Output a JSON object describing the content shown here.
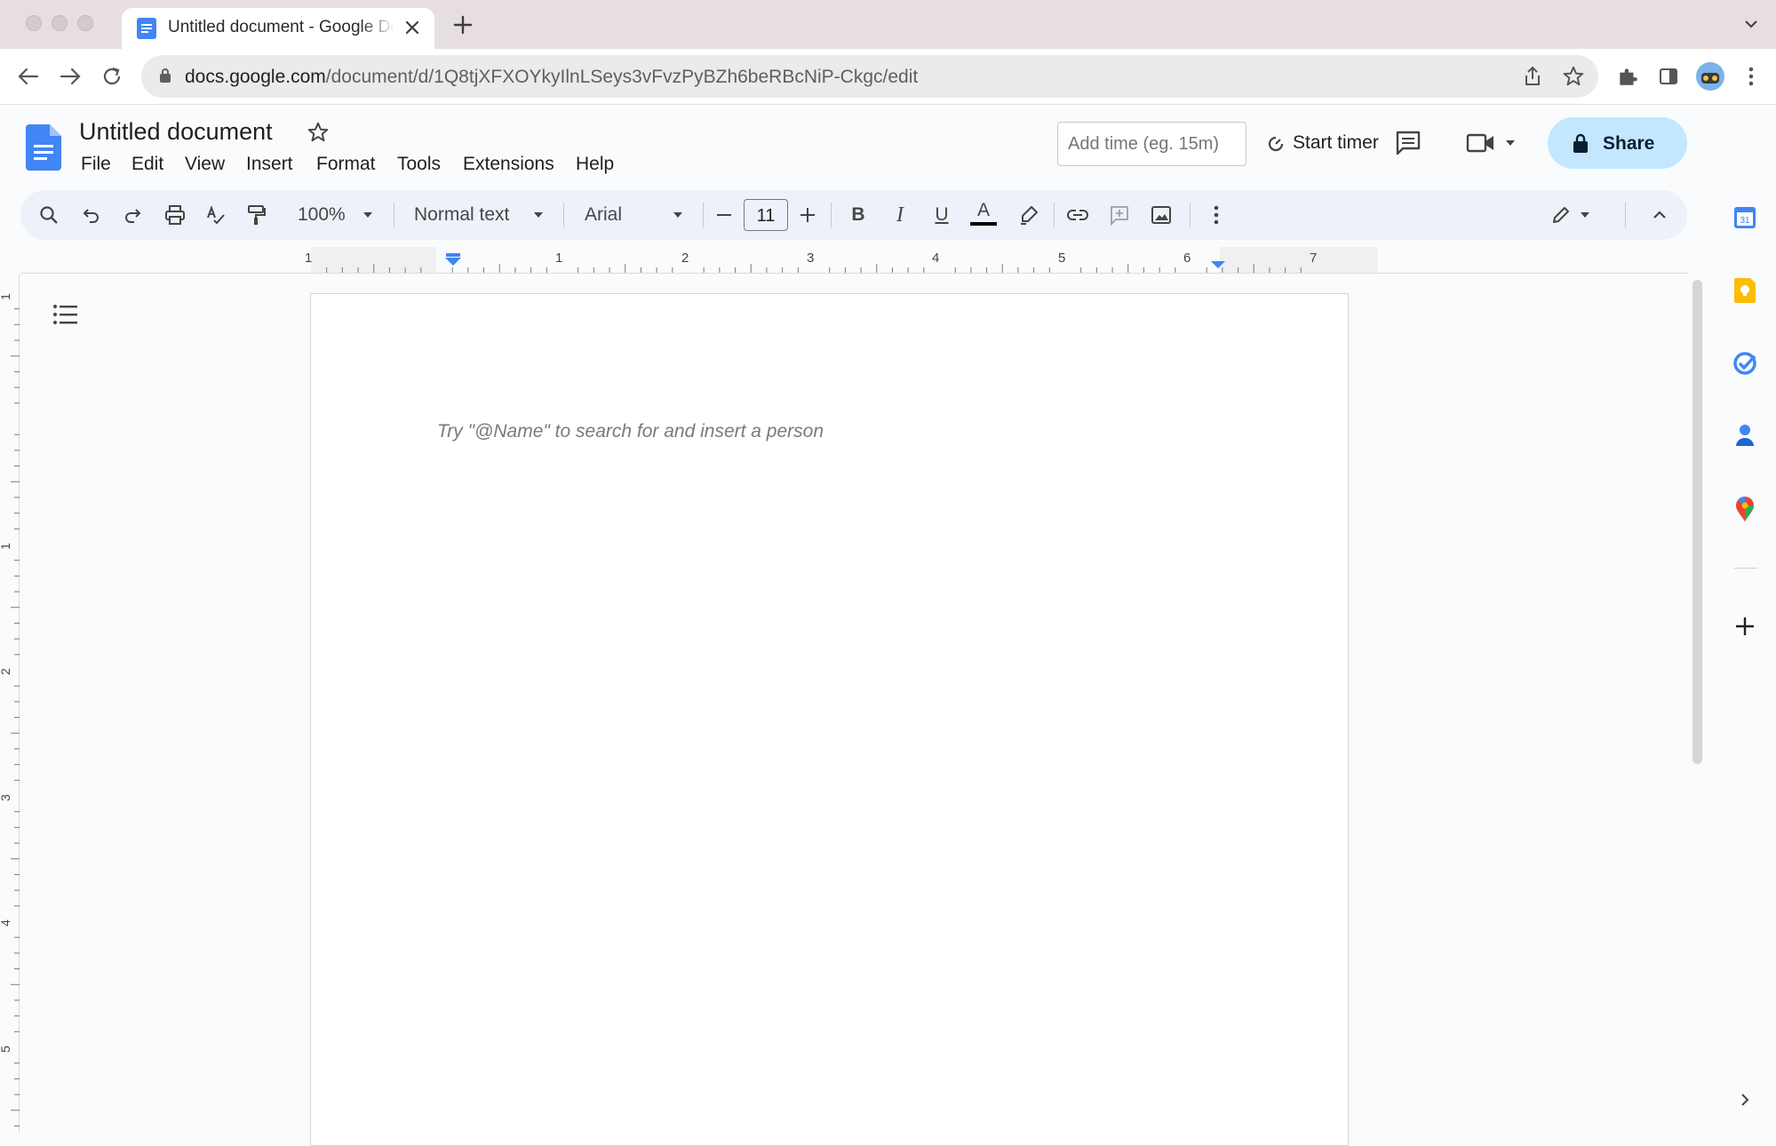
{
  "browser": {
    "tab": {
      "title": "Untitled document - Google Docs",
      "icon": "docs-icon"
    },
    "new_tab_label": "+",
    "url": {
      "host": "docs.google.com",
      "path": "/document/d/1Q8tjXFXOYkyIlnLSeys3vFvzPyBZh6beRBcNiP-Ckgc/edit"
    }
  },
  "doc": {
    "title": "Untitled document",
    "menu": [
      "File",
      "Edit",
      "View",
      "Insert",
      "Format",
      "Tools",
      "Extensions",
      "Help"
    ],
    "add_time_placeholder": "Add time (eg. 15m)",
    "start_timer_label": "Start timer",
    "share_label": "Share"
  },
  "toolbar": {
    "zoom": "100%",
    "style": "Normal text",
    "font": "Arial",
    "font_size": "11",
    "bold_label": "B",
    "italic_label": "I",
    "underline_label": "U",
    "text_color_label": "A",
    "text_color": "#000000"
  },
  "ruler": {
    "horizontal": [
      "1",
      "1",
      "2",
      "3",
      "4",
      "5",
      "6",
      "7"
    ],
    "vertical": [
      "1",
      "1",
      "2",
      "3",
      "4",
      "5"
    ]
  },
  "page": {
    "placeholder": "Try \"@Name\" to search for and insert a person"
  },
  "side_panel": [
    "calendar-icon",
    "keep-icon",
    "tasks-icon",
    "contacts-icon",
    "maps-icon",
    "add-icon",
    "expand-icon"
  ],
  "colors": {
    "docs_blue": "#4285f4",
    "share_bg": "#c2e7ff",
    "toolbar_bg": "#edf2fa"
  }
}
